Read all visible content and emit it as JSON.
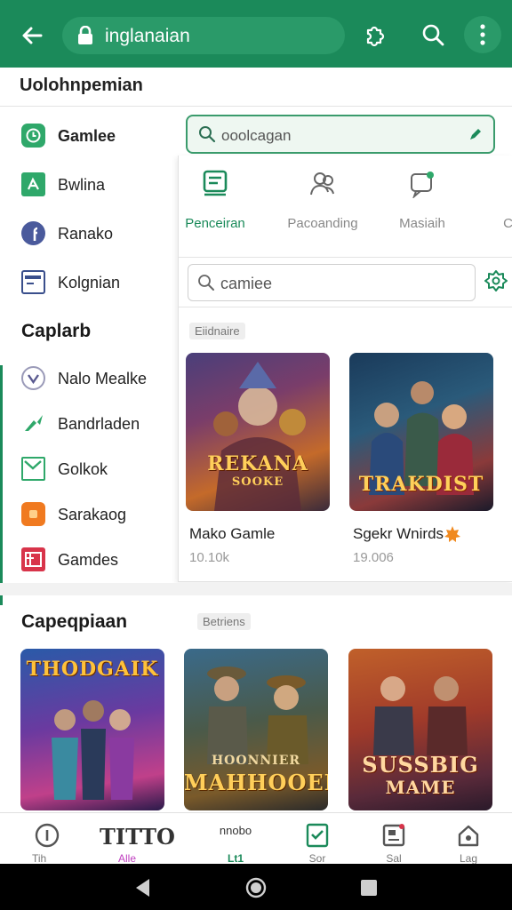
{
  "topbar": {
    "back_icon": "back-arrow-icon",
    "url_text": "inglanaian",
    "icons": [
      "puzzle-icon",
      "search-icon",
      "more-vert-icon"
    ],
    "brand_color": "#1b8a5a"
  },
  "subheader": {
    "title": "Uolohnpemian"
  },
  "sidebar": {
    "items": [
      {
        "label": "Gamlee",
        "icon": "clock-icon",
        "color": "#2fa86a",
        "bold": true
      },
      {
        "label": "Bwlina",
        "icon": "leaf-icon",
        "color": "#2fa86a"
      },
      {
        "label": "Ranako",
        "icon": "facebook-icon",
        "color": "#4a5a9c"
      },
      {
        "label": "Kolgnian",
        "icon": "window-icon",
        "color": "#3a4f8c"
      }
    ],
    "section_title": "Caplarb",
    "section_items": [
      {
        "label": "Nalo Mealke",
        "icon": "shield-icon",
        "color": "#6a6aa0"
      },
      {
        "label": "Bandrladen",
        "icon": "arrow-icon",
        "color": "#2fa86a"
      },
      {
        "label": "Golkok",
        "icon": "mail-icon",
        "color": "#2fa86a"
      },
      {
        "label": "Sarakaog",
        "icon": "square-icon",
        "color": "#f07a20"
      },
      {
        "label": "Gamdes",
        "icon": "grid-icon",
        "color": "#d8344a"
      }
    ]
  },
  "search_top": {
    "value": "ooolcagan",
    "icon": "search-icon",
    "action_icon": "pencil-icon"
  },
  "panel": {
    "tabs": [
      {
        "label": "Penceiran",
        "icon": "document-icon",
        "active": true
      },
      {
        "label": "Pacoanding",
        "icon": "people-icon"
      },
      {
        "label": "Masiaih",
        "icon": "chat-icon"
      },
      {
        "label": "C",
        "icon": ""
      }
    ],
    "search": {
      "value": "camiee",
      "icon": "search-icon"
    },
    "settings_icon": "gear-icon",
    "chip": "Eiidnaire",
    "games": [
      {
        "title": "Mako Gamle",
        "sub": "10.10k",
        "art_text": "REKANA",
        "art_sub": "SOOKE"
      },
      {
        "title": "Sgekr Wnirds",
        "sub": "19.006",
        "art_text": "TRAKDIST",
        "badge_icon": "star-badge-icon"
      }
    ]
  },
  "section2": {
    "title": "Capeqpiaan",
    "chip": "Betriens",
    "cards": [
      {
        "art_text": "THODGAIK"
      },
      {
        "art_text": "MAHHOOER",
        "art_top": "HOONNIER"
      },
      {
        "art_text": "SUSSBIG",
        "art_sub": "MAME"
      }
    ]
  },
  "bottom_nav": {
    "items": [
      {
        "label": "Tih",
        "icon": "info-icon",
        "overlay": "TITTO"
      },
      {
        "label": "Alle",
        "icon": "",
        "top": "nnobo",
        "accent": "#c040c0"
      },
      {
        "label": "Lt1",
        "icon": "",
        "accent": "#1b8a5a"
      },
      {
        "label": "Sor",
        "icon": "check-doc-icon"
      },
      {
        "label": "Sal",
        "icon": "profile-card-icon"
      },
      {
        "label": "Lag",
        "icon": "home-icon"
      }
    ]
  },
  "system_nav": {
    "icons": [
      "back-triangle-icon",
      "home-circle-icon",
      "recents-square-icon"
    ]
  }
}
